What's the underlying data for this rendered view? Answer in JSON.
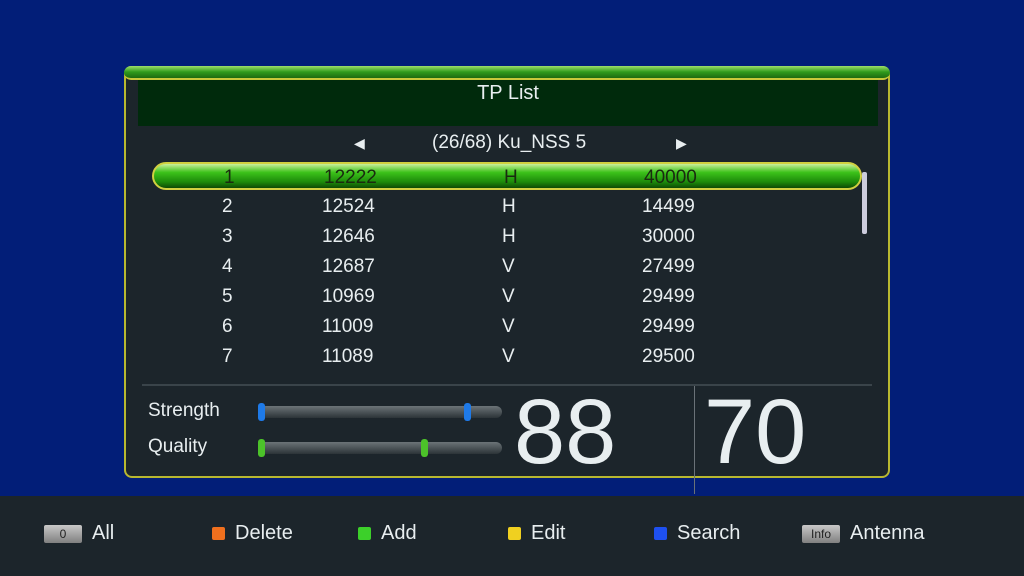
{
  "title": "TP List",
  "satellite": "(26/68) Ku_NSS 5",
  "rows": [
    [
      "1",
      "12222",
      "H",
      "40000"
    ],
    [
      "2",
      "12524",
      "H",
      "14499"
    ],
    [
      "3",
      "12646",
      "H",
      "30000"
    ],
    [
      "4",
      "12687",
      "V",
      "27499"
    ],
    [
      "5",
      "10969",
      "V",
      "29499"
    ],
    [
      "6",
      "11009",
      "V",
      "29499"
    ],
    [
      "7",
      "11089",
      "V",
      "29500"
    ]
  ],
  "selected_row": 0,
  "signal": {
    "strength_label": "Strength",
    "quality_label": "Quality",
    "strength": "88",
    "quality": "70",
    "strength_pct": 86,
    "quality_pct": 68,
    "strength_color": "#1e7ae8",
    "quality_color": "#4cc22a"
  },
  "footer": [
    {
      "key": "0",
      "label": "All"
    },
    {
      "color": "#f0701e",
      "label": "Delete"
    },
    {
      "color": "#3cd02a",
      "label": "Add"
    },
    {
      "color": "#f0d020",
      "label": "Edit"
    },
    {
      "color": "#1e50f0",
      "label": "Search"
    },
    {
      "key": "Info",
      "label": "Antenna"
    }
  ]
}
